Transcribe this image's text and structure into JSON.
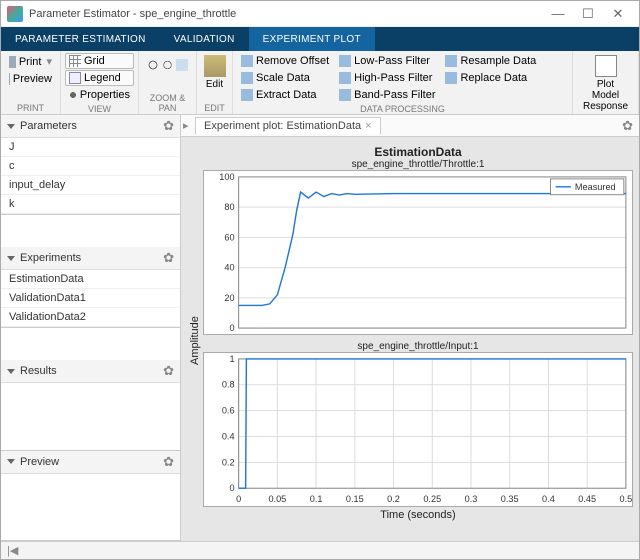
{
  "window": {
    "title": "Parameter Estimator - spe_engine_throttle"
  },
  "tabs": {
    "parameter_estimation": "PARAMETER ESTIMATION",
    "validation": "VALIDATION",
    "experiment_plot": "EXPERIMENT PLOT"
  },
  "ribbon": {
    "print": {
      "print": "Print",
      "preview": "Preview",
      "group": "PRINT"
    },
    "view": {
      "grid": "Grid",
      "legend": "Legend",
      "properties": "Properties",
      "group": "VIEW"
    },
    "zoompan": {
      "group": "ZOOM & PAN"
    },
    "edit": {
      "edit": "Edit",
      "group": "EDIT"
    },
    "data": {
      "remove_offset": "Remove Offset",
      "scale_data": "Scale Data",
      "extract_data": "Extract Data",
      "low_pass": "Low-Pass Filter",
      "high_pass": "High-Pass Filter",
      "band_pass": "Band-Pass Filter",
      "resample": "Resample Data",
      "replace": "Replace Data",
      "group": "DATA PROCESSING"
    },
    "plot": {
      "plot_model_response": "Plot Model\nResponse",
      "group": "PLOT"
    }
  },
  "panels": {
    "parameters": {
      "title": "Parameters",
      "items": [
        "J",
        "c",
        "input_delay",
        "k"
      ]
    },
    "experiments": {
      "title": "Experiments",
      "items": [
        "EstimationData",
        "ValidationData1",
        "ValidationData2"
      ]
    },
    "results": {
      "title": "Results"
    },
    "preview": {
      "title": "Preview"
    }
  },
  "doc_tab": {
    "label": "Experiment plot: EstimationData",
    "close": "×"
  },
  "chart_data": [
    {
      "type": "line",
      "title": "EstimationData",
      "subtitle": "spe_engine_throttle/Throttle:1",
      "xlim": [
        0,
        0.5
      ],
      "ylim": [
        0,
        100
      ],
      "yticks": [
        0,
        20,
        40,
        60,
        80,
        100
      ],
      "legend": "Measured",
      "series": [
        {
          "name": "Measured",
          "x": [
            0,
            0.01,
            0.02,
            0.03,
            0.04,
            0.05,
            0.06,
            0.07,
            0.075,
            0.08,
            0.09,
            0.1,
            0.11,
            0.12,
            0.13,
            0.14,
            0.15,
            0.2,
            0.3,
            0.4,
            0.5
          ],
          "y": [
            15,
            15,
            15,
            15,
            16,
            22,
            40,
            62,
            78,
            90,
            86,
            90,
            87,
            89,
            88,
            89,
            88.5,
            89,
            89,
            89,
            89
          ]
        }
      ]
    },
    {
      "type": "line",
      "subtitle": "spe_engine_throttle/Input:1",
      "xlabel": "Time (seconds)",
      "xlim": [
        0,
        0.5
      ],
      "ylim": [
        0,
        1
      ],
      "xticks": [
        0,
        0.05,
        0.1,
        0.15,
        0.2,
        0.25,
        0.3,
        0.35,
        0.4,
        0.45,
        0.5
      ],
      "yticks": [
        0,
        0.2,
        0.4,
        0.6,
        0.8,
        1
      ],
      "series": [
        {
          "name": "Measured",
          "x": [
            0,
            0.009,
            0.01,
            0.5
          ],
          "y": [
            0,
            0,
            1,
            1
          ]
        }
      ]
    }
  ],
  "axis_y_label": "Amplitude",
  "status_icon": "|◀"
}
